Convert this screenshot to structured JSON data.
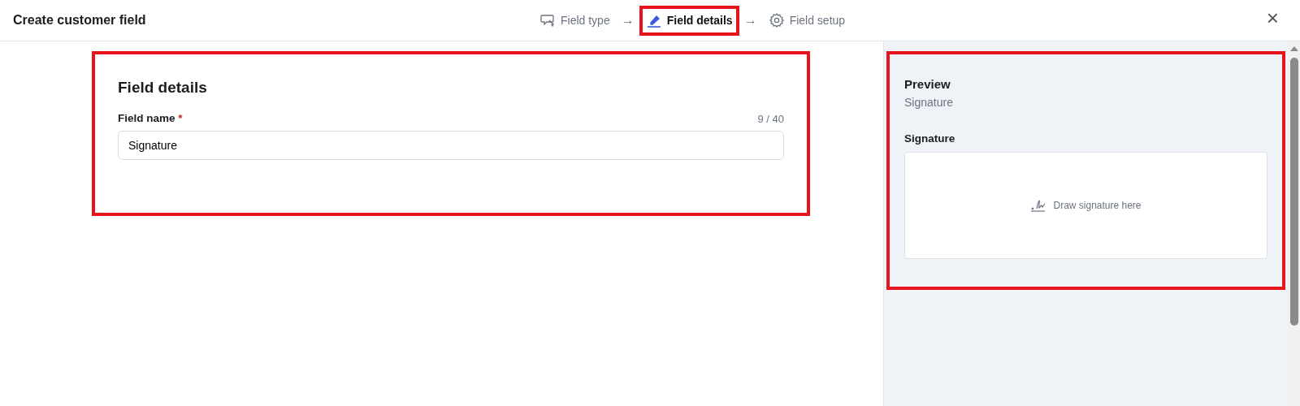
{
  "header": {
    "title": "Create customer field",
    "close_label": "×"
  },
  "steps": [
    {
      "label": "Field type",
      "selected": false,
      "highlighted": false
    },
    {
      "label": "Field details",
      "selected": true,
      "highlighted": true
    },
    {
      "label": "Field setup",
      "selected": false,
      "highlighted": false
    }
  ],
  "step_separator": "→",
  "form": {
    "title": "Field details",
    "highlighted": true,
    "field": {
      "label": "Field name",
      "required_mark": "*",
      "counter": "9 / 40",
      "value": "Signature"
    }
  },
  "preview": {
    "title": "Preview",
    "subtitle": "Signature",
    "highlighted": true,
    "field_label": "Signature",
    "pad_hint": "Draw signature here"
  }
}
